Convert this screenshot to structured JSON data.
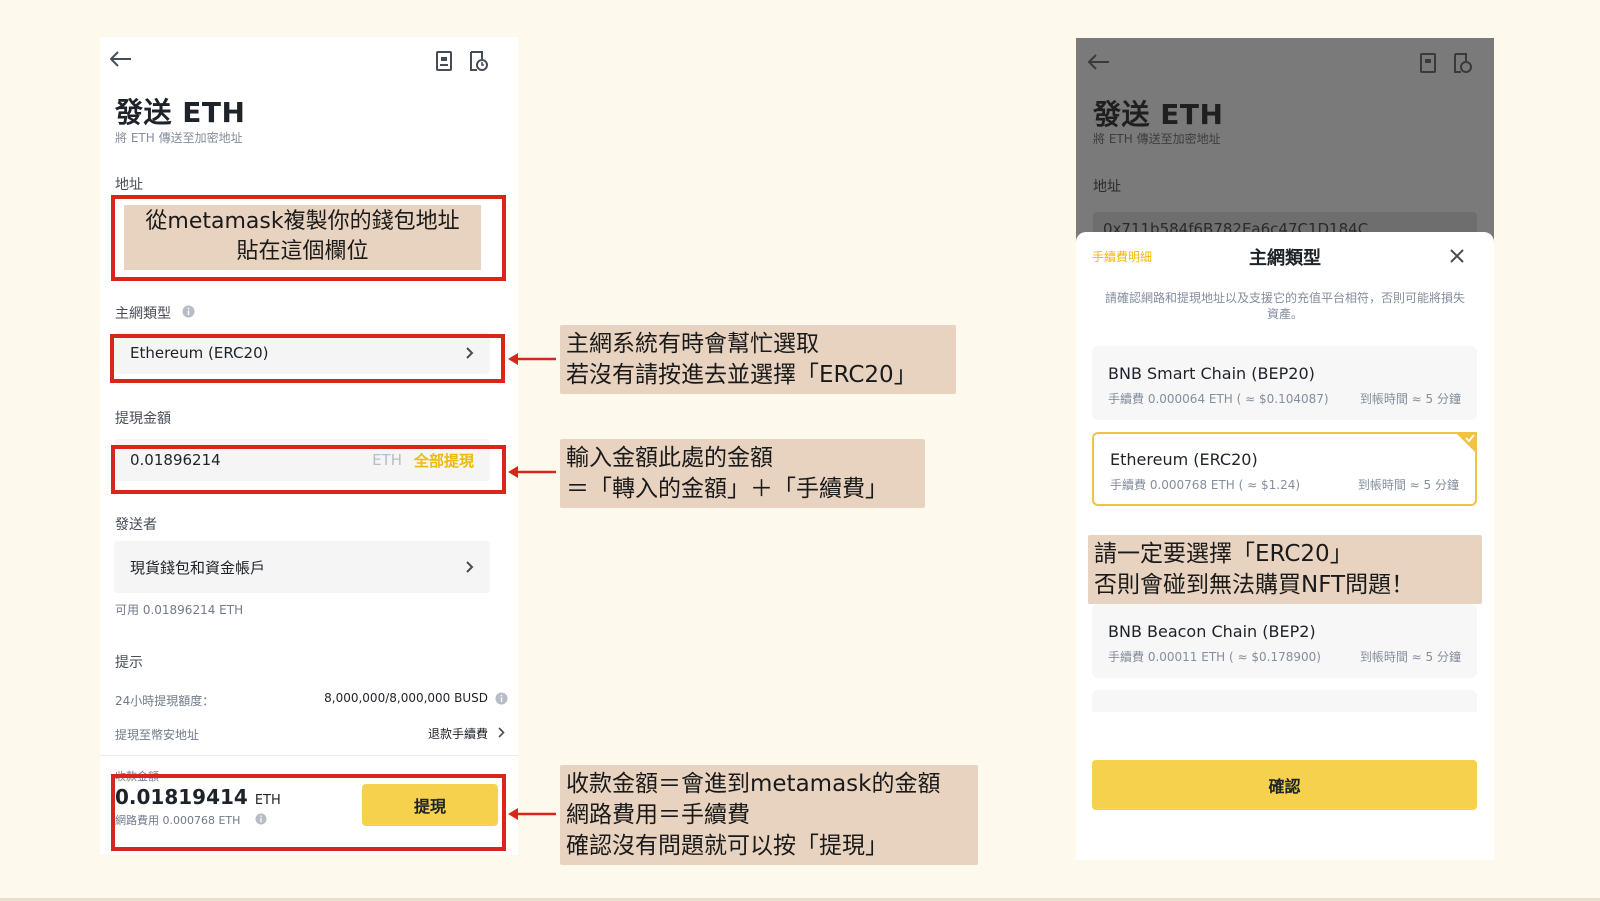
{
  "left": {
    "title": "發送 ETH",
    "subtitle": "將 ETH 傳送至加密地址",
    "address_label": "地址",
    "address_note": "從metamask複製你的錢包地址\n貼在這個欄位",
    "network_label": "主網類型",
    "network_value": "Ethereum (ERC20)",
    "amount_label": "提現金額",
    "amount_value": "0.01896214",
    "amount_unit": "ETH",
    "withdraw_all": "全部提現",
    "sender_label": "發送者",
    "sender_value": "現貨錢包和資金帳戶",
    "available": "可用 0.01896214 ETH",
    "tips_label": "提示",
    "limit_label": "24小時提現額度：",
    "limit_value": "8,000,000/8,000,000 BUSD",
    "refund_label": "提現至幣安地址",
    "refund_value": "退款手續費",
    "receive_label": "收款金額",
    "receive_value": "0.01819414",
    "receive_unit": "ETH",
    "network_fee": "網路費用 0.000768 ETH",
    "withdraw_button": "提現"
  },
  "notes": {
    "network": "主網系統有時會幫忙選取\n若沒有請按進去並選擇「ERC20」",
    "amount": "輸入金額此處的金額\n＝「轉入的金額」＋「手續費」",
    "receive": "收款金額＝會進到metamask的金額\n網路費用＝手續費\n確認沒有問題就可以按「提現」",
    "erc20": "請一定要選擇「ERC20」\n否則會碰到無法購買NFT問題！"
  },
  "right": {
    "title": "發送 ETH",
    "subtitle": "將 ETH 傳送至加密地址",
    "address_label": "地址",
    "address_partial": "0x711b584f6B782Ea6c47C1D184C",
    "fee_details_link": "手續費明細",
    "sheet_title": "主網類型",
    "warning": "請確認網路和提現地址以及支援它的充值平台相符，否則可能將損失資產。",
    "networks": [
      {
        "name": "BNB Smart Chain (BEP20)",
        "fee": "手續費 0.000064 ETH ( ≈ $0.104087)",
        "time": "到帳時間 ≈ 5 分鐘"
      },
      {
        "name": "Ethereum (ERC20)",
        "fee": "手續費 0.000768 ETH ( ≈ $1.24)",
        "time": "到帳時間 ≈ 5 分鐘"
      },
      {
        "name": "BNB Beacon Chain (BEP2)",
        "fee": "手續費 0.00011 ETH ( ≈ $0.178900)",
        "time": "到帳時間 ≈ 5 分鐘"
      }
    ],
    "confirm_button": "確認"
  },
  "colors": {
    "accent_yellow": "#f0b90b",
    "annotation_red": "#d9261c",
    "note_bg": "#e8d3c0"
  }
}
